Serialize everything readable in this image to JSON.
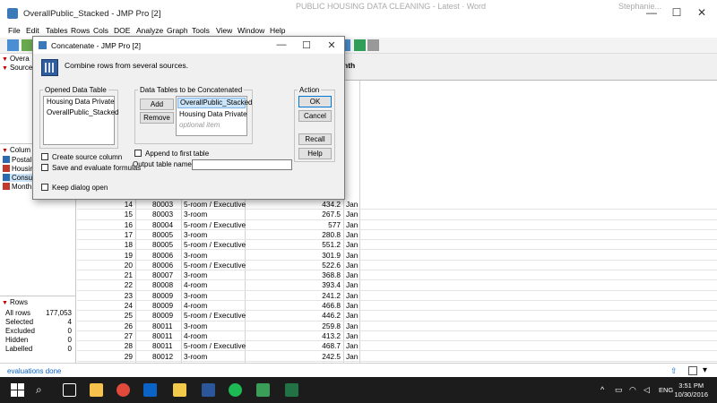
{
  "window": {
    "title": "OverallPublic_Stacked - JMP Pro [2]",
    "bg_title": "PUBLIC HOUSING DATA CLEANING - Latest · Word",
    "bg_title2": "Stephanie..."
  },
  "menu": [
    "File",
    "Edit",
    "Tables",
    "Rows",
    "Cols",
    "DOE",
    "Analyze",
    "Graph",
    "Tools",
    "View",
    "Window",
    "Help"
  ],
  "left": {
    "panel1": "Overa",
    "panel2": "Source",
    "columns_header": "Colum",
    "columns": [
      {
        "label": "Postal",
        "color": "#2b6cb0"
      },
      {
        "label": "Housin",
        "color": "#c0392b"
      },
      {
        "label": "Consu",
        "color": "#2b6cb0"
      },
      {
        "label": "Month",
        "color": "#c0392b"
      }
    ],
    "rows_header": "Rows",
    "rows": [
      {
        "label": "All rows",
        "value": "177,053"
      },
      {
        "label": "Selected",
        "value": "4"
      },
      {
        "label": "Excluded",
        "value": "0"
      },
      {
        "label": "Hidden",
        "value": "0"
      },
      {
        "label": "Labelled",
        "value": "0"
      }
    ]
  },
  "grid": {
    "header_partial": "nth",
    "rows": [
      {
        "n": "14",
        "postal": "80003",
        "type": "5-room / Executive",
        "val": "434.2",
        "m": "Jan"
      },
      {
        "n": "15",
        "postal": "80003",
        "type": "3-room",
        "val": "267.5",
        "m": "Jan"
      },
      {
        "n": "16",
        "postal": "80004",
        "type": "5-room / Executive",
        "val": "577",
        "m": "Jan"
      },
      {
        "n": "17",
        "postal": "80005",
        "type": "3-room",
        "val": "280.8",
        "m": "Jan"
      },
      {
        "n": "18",
        "postal": "80005",
        "type": "5-room / Executive",
        "val": "551.2",
        "m": "Jan"
      },
      {
        "n": "19",
        "postal": "80006",
        "type": "3-room",
        "val": "301.9",
        "m": "Jan"
      },
      {
        "n": "20",
        "postal": "80006",
        "type": "5-room / Executive",
        "val": "522.6",
        "m": "Jan"
      },
      {
        "n": "21",
        "postal": "80007",
        "type": "3-room",
        "val": "368.8",
        "m": "Jan"
      },
      {
        "n": "22",
        "postal": "80008",
        "type": "4-room",
        "val": "393.4",
        "m": "Jan"
      },
      {
        "n": "23",
        "postal": "80009",
        "type": "3-room",
        "val": "241.2",
        "m": "Jan"
      },
      {
        "n": "24",
        "postal": "80009",
        "type": "4-room",
        "val": "466.8",
        "m": "Jan"
      },
      {
        "n": "25",
        "postal": "80009",
        "type": "5-room / Executive",
        "val": "446.2",
        "m": "Jan"
      },
      {
        "n": "26",
        "postal": "80011",
        "type": "3-room",
        "val": "259.8",
        "m": "Jan"
      },
      {
        "n": "27",
        "postal": "80011",
        "type": "4-room",
        "val": "413.2",
        "m": "Jan"
      },
      {
        "n": "28",
        "postal": "80011",
        "type": "5-room / Executive",
        "val": "468.7",
        "m": "Jan"
      },
      {
        "n": "29",
        "postal": "80012",
        "type": "3-room",
        "val": "242.5",
        "m": "Jan"
      }
    ]
  },
  "status": "evaluations done",
  "dialog": {
    "title": "Concatenate - JMP Pro [2]",
    "description": "Combine rows from several sources.",
    "opened_label": "Opened Data Table",
    "opened_items": [
      "Housing Data Private",
      "OverallPublic_Stacked"
    ],
    "concat_label": "Data Tables to be Concatenated",
    "concat_items": [
      "OverallPublic_Stacked",
      "Housing Data Private"
    ],
    "concat_optional": "optional item",
    "add": "Add",
    "remove": "Remove",
    "action_label": "Action",
    "ok": "OK",
    "cancel": "Cancel",
    "recall": "Recall",
    "help": "Help",
    "create_source": "Create source column",
    "save_formulas": "Save and evaluate formulas",
    "keep_open": "Keep dialog open",
    "append_first": "Append to first table",
    "output_name_label": "Output table name:",
    "output_name_value": ""
  },
  "taskbar": {
    "time": "3:51 PM",
    "date": "10/30/2016",
    "lang": "ENG"
  }
}
